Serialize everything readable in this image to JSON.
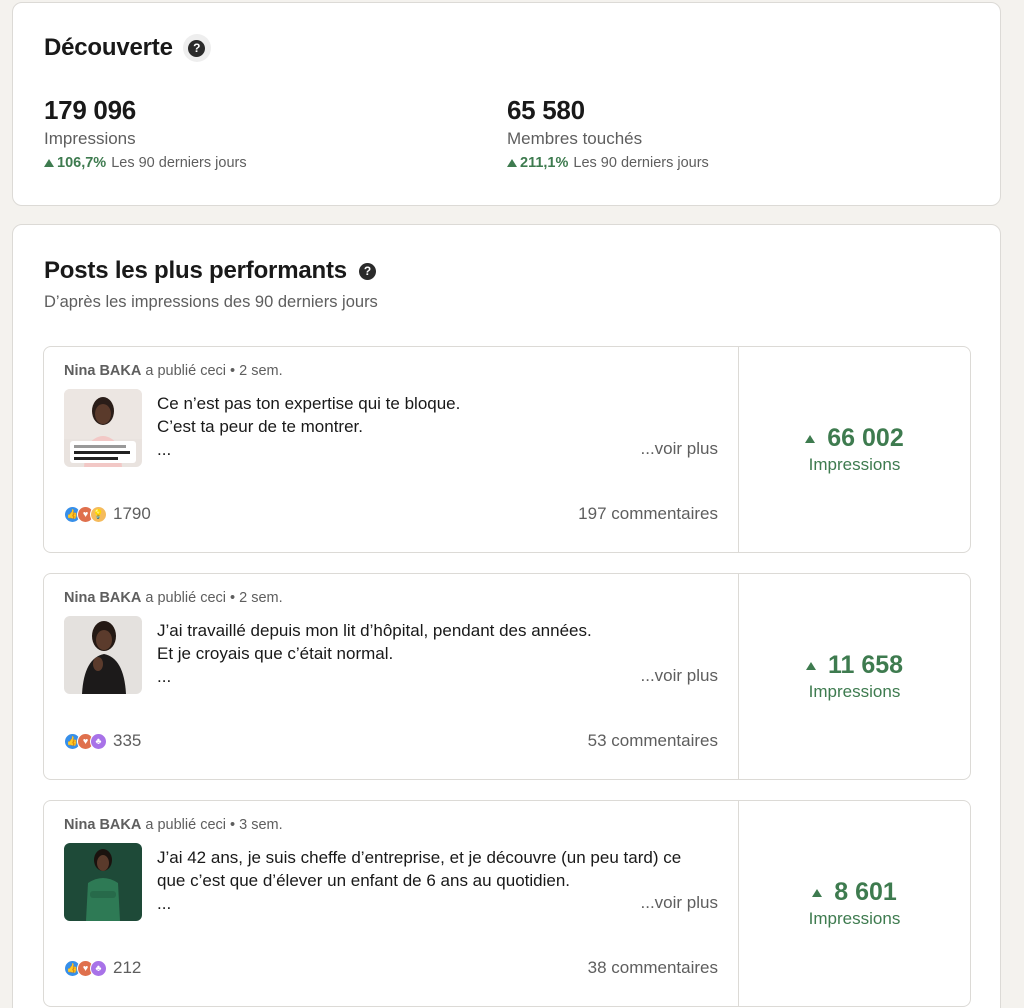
{
  "discovery": {
    "title": "Découverte",
    "help_icon": "question-circle-icon",
    "metrics": [
      {
        "value": "179 096",
        "label": "Impressions",
        "trend": "106,7%",
        "period": "Les 90 derniers jours"
      },
      {
        "value": "65 580",
        "label": "Membres touchés",
        "trend": "211,1%",
        "period": "Les 90 derniers jours"
      }
    ]
  },
  "top_posts": {
    "title": "Posts les plus performants",
    "subtitle": "D’après les impressions des 90 derniers jours",
    "posts": [
      {
        "author": "Nina BAKA",
        "action": " a publié ceci • 2 sem.",
        "line1": "Ce n’est pas ton expertise qui te bloque.",
        "line2": "C’est ta peur de te montrer.",
        "line3": "...",
        "see_more": "...voir plus",
        "reactions": "1790",
        "comments": "197 commentaires",
        "impressions": "66 002",
        "impressions_label": "Impressions"
      },
      {
        "author": "Nina BAKA",
        "action": " a publié ceci • 2 sem.",
        "line1": "J’ai travaillé depuis mon lit d’hôpital, pendant des années.",
        "line2": "Et je croyais que c’était normal.",
        "line3": "...",
        "see_more": "...voir plus",
        "reactions": "335",
        "comments": "53 commentaires",
        "impressions": "11 658",
        "impressions_label": "Impressions"
      },
      {
        "author": "Nina BAKA",
        "action": " a publié ceci • 3 sem.",
        "line1": "J’ai 42 ans, je suis cheffe d’entreprise, et je découvre (un peu tard) ce",
        "line2": "que c’est que d’élever un enfant de 6 ans au quotidien.",
        "line3": "...",
        "see_more": "...voir plus",
        "reactions": "212",
        "comments": "38 commentaires",
        "impressions": "8 601",
        "impressions_label": "Impressions"
      }
    ]
  },
  "colors": {
    "accent_green": "#3e7b4f",
    "background": "#f4f2ee"
  }
}
